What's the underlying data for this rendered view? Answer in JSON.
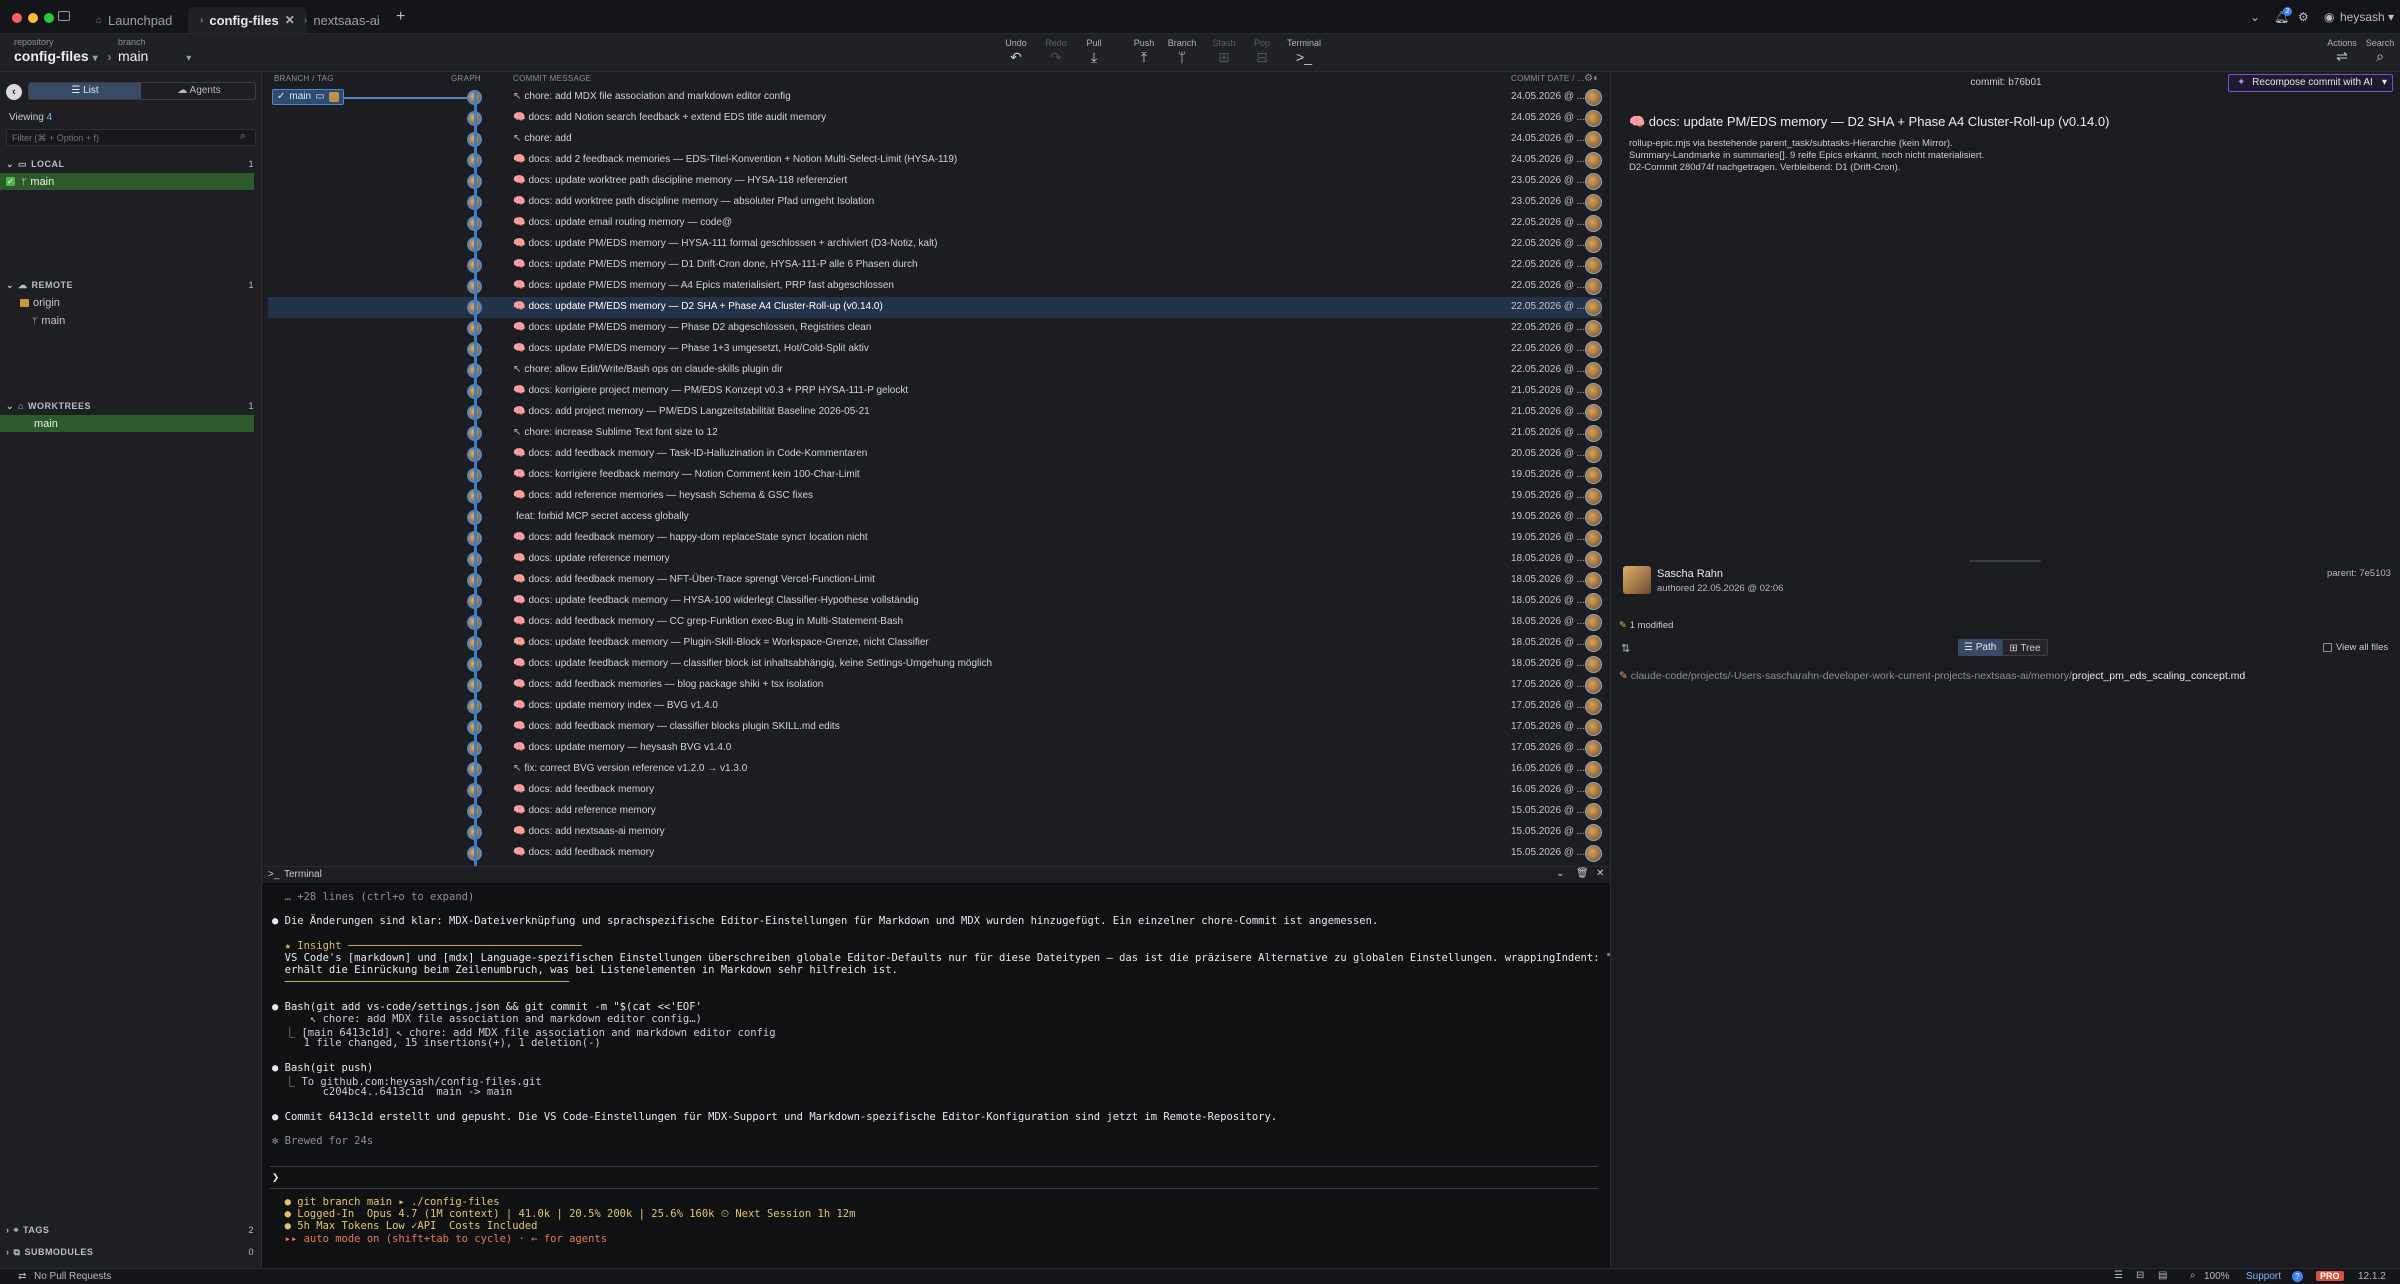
{
  "titlebar": {
    "tabs": [
      {
        "label": "Launchpad",
        "active": false
      },
      {
        "label": "config-files",
        "active": true
      },
      {
        "label": "nextsaas-ai",
        "active": false
      }
    ],
    "notification_count": "2",
    "user": "heysash"
  },
  "toolbar": {
    "repository_label": "repository",
    "repository": "config-files",
    "branch_label": "branch",
    "branch": "main",
    "tools": [
      {
        "label": "Undo",
        "icon": "↶",
        "enabled": true
      },
      {
        "label": "Redo",
        "icon": "↷",
        "enabled": false
      },
      {
        "label": "Pull",
        "icon": "⤓",
        "enabled": true
      },
      {
        "label": "Push",
        "icon": "⤒",
        "enabled": true
      },
      {
        "label": "Branch",
        "icon": "ᛘ",
        "enabled": true
      },
      {
        "label": "Stash",
        "icon": "⊞",
        "enabled": false
      },
      {
        "label": "Pop",
        "icon": "⊟",
        "enabled": false
      },
      {
        "label": "Terminal",
        "icon": ">_",
        "enabled": true
      }
    ],
    "actions_label": "Actions",
    "search_label": "Search"
  },
  "left": {
    "view_list": "List",
    "view_agents": "Agents",
    "viewing_label": "Viewing",
    "viewing_count": "4",
    "filter_placeholder": "Filter (⌘ + Option + f)",
    "local": {
      "title": "LOCAL",
      "count": "1",
      "items": [
        "main"
      ]
    },
    "remote": {
      "title": "REMOTE",
      "count": "1",
      "origin": "origin",
      "items": [
        "main"
      ]
    },
    "worktrees": {
      "title": "WORKTREES",
      "count": "1",
      "items": [
        "main"
      ]
    },
    "tags": {
      "title": "TAGS",
      "count": "2"
    },
    "submodules": {
      "title": "SUBMODULES",
      "count": "0"
    }
  },
  "list": {
    "headers": {
      "branch": "BRANCH / TAG",
      "graph": "GRAPH",
      "message": "COMMIT MESSAGE",
      "date": "COMMIT DATE / ..."
    },
    "branch_tag": "main",
    "selected_index": 10,
    "commits": [
      {
        "icon": "↖",
        "message": "chore: add MDX file association and markdown editor config",
        "date": "24.05.2026 @ ..."
      },
      {
        "icon": "🧠",
        "message": "docs: add Notion search feedback + extend EDS title audit memory",
        "date": "24.05.2026 @ ..."
      },
      {
        "icon": "↖",
        "message": "chore: add",
        "date": "24.05.2026 @ ..."
      },
      {
        "icon": "🧠",
        "message": "docs: add 2 feedback memories — EDS-Titel-Konvention + Notion Multi-Select-Limit (HYSA-119)",
        "date": "24.05.2026 @ ..."
      },
      {
        "icon": "🧠",
        "message": "docs: update worktree path discipline memory — HYSA-118 referenziert",
        "date": "23.05.2026 @ ..."
      },
      {
        "icon": "🧠",
        "message": "docs: add worktree path discipline memory — absoluter Pfad umgeht Isolation",
        "date": "23.05.2026 @ ..."
      },
      {
        "icon": "🧠",
        "message": "docs: update email routing memory — code@",
        "date": "22.05.2026 @ ..."
      },
      {
        "icon": "🧠",
        "message": "docs: update PM/EDS memory — HYSA-111 formal geschlossen + archiviert (D3-Notiz, kalt)",
        "date": "22.05.2026 @ ..."
      },
      {
        "icon": "🧠",
        "message": "docs: update PM/EDS memory — D1 Drift-Cron done, HYSA-111-P alle 6 Phasen durch",
        "date": "22.05.2026 @ ..."
      },
      {
        "icon": "🧠",
        "message": "docs: update PM/EDS memory — A4 Epics materialisiert, PRP fast abgeschlossen",
        "date": "22.05.2026 @ ..."
      },
      {
        "icon": "🧠",
        "message": "docs: update PM/EDS memory — D2 SHA + Phase A4 Cluster-Roll-up (v0.14.0)",
        "date": "22.05.2026 @ ..."
      },
      {
        "icon": "🧠",
        "message": "docs: update PM/EDS memory — Phase D2 abgeschlossen, Registries clean",
        "date": "22.05.2026 @ ..."
      },
      {
        "icon": "🧠",
        "message": "docs: update PM/EDS memory — Phase 1+3 umgesetzt, Hot/Cold-Split aktiv",
        "date": "22.05.2026 @ ..."
      },
      {
        "icon": "↖",
        "message": "chore: allow Edit/Write/Bash ops on claude-skills plugin dir",
        "date": "22.05.2026 @ ..."
      },
      {
        "icon": "🧠",
        "message": "docs: korrigiere project memory — PM/EDS Konzept v0.3 + PRP HYSA-111-P gelockt",
        "date": "21.05.2026 @ ..."
      },
      {
        "icon": "🧠",
        "message": "docs: add project memory — PM/EDS Langzeitstabilität Baseline 2026-05-21",
        "date": "21.05.2026 @ ..."
      },
      {
        "icon": "↖",
        "message": "chore: increase Sublime Text font size to 12",
        "date": "21.05.2026 @ ..."
      },
      {
        "icon": "🧠",
        "message": "docs: add feedback memory — Task-ID-Halluzination in Code-Kommentaren",
        "date": "20.05.2026 @ ..."
      },
      {
        "icon": "🧠",
        "message": "docs: korrigiere feedback memory — Notion Comment kein 100-Char-Limit",
        "date": "19.05.2026 @ ..."
      },
      {
        "icon": "🧠",
        "message": "docs: add reference memories — heysash Schema & GSC fixes",
        "date": "19.05.2026 @ ..."
      },
      {
        "icon": "",
        "message": "feat: forbid MCP secret access globally",
        "date": "19.05.2026 @ ..."
      },
      {
        "icon": "🧠",
        "message": "docs: add feedback memory — happy-dom replaceState syncт location nicht",
        "date": "19.05.2026 @ ..."
      },
      {
        "icon": "🧠",
        "message": "docs: update reference memory",
        "date": "18.05.2026 @ ..."
      },
      {
        "icon": "🧠",
        "message": "docs: add feedback memory — NFT-Über-Trace sprengt Vercel-Function-Limit",
        "date": "18.05.2026 @ ..."
      },
      {
        "icon": "🧠",
        "message": "docs: update feedback memory — HYSA-100 widerlegt Classifier-Hypothese vollständig",
        "date": "18.05.2026 @ ..."
      },
      {
        "icon": "🧠",
        "message": "docs: add feedback memory — CC grep-Funktion exec-Bug in Multi-Statement-Bash",
        "date": "18.05.2026 @ ..."
      },
      {
        "icon": "🧠",
        "message": "docs: update feedback memory — Plugin-Skill-Block = Workspace-Grenze, nicht Classifier",
        "date": "18.05.2026 @ ..."
      },
      {
        "icon": "🧠",
        "message": "docs: update feedback memory — classifier block ist inhaltsabhängig, keine Settings-Umgehung möglich",
        "date": "18.05.2026 @ ..."
      },
      {
        "icon": "🧠",
        "message": "docs: add feedback memories — blog package shiki + tsx isolation",
        "date": "17.05.2026 @ ..."
      },
      {
        "icon": "🧠",
        "message": "docs: update memory index — BVG v1.4.0",
        "date": "17.05.2026 @ ..."
      },
      {
        "icon": "🧠",
        "message": "docs: add feedback memory — classifier blocks plugin SKILL.md edits",
        "date": "17.05.2026 @ ..."
      },
      {
        "icon": "🧠",
        "message": "docs: update memory — heysash BVG v1.4.0",
        "date": "17.05.2026 @ ..."
      },
      {
        "icon": "↖",
        "message": "fix: correct BVG version reference v1.2.0 → v1.3.0",
        "date": "16.05.2026 @ ..."
      },
      {
        "icon": "🧠",
        "message": "docs: add feedback memory",
        "date": "16.05.2026 @ ..."
      },
      {
        "icon": "🧠",
        "message": "docs: add reference memory",
        "date": "15.05.2026 @ ..."
      },
      {
        "icon": "🧠",
        "message": "docs: add nextsaas-ai memory",
        "date": "15.05.2026 @ ..."
      },
      {
        "icon": "🧠",
        "message": "docs: add feedback memory",
        "date": "15.05.2026 @ ..."
      }
    ]
  },
  "terminal": {
    "title": "Terminal",
    "lines": [
      {
        "text": "  … +28 lines (ctrl+o to expand)",
        "color": "#8b9099"
      },
      {
        "text": "",
        "color": "#d4d6da"
      },
      {
        "text": "● Die Änderungen sind klar: MDX-Dateiverknüpfung und sprachspezifische Editor-Einstellungen für Markdown und MDX wurden hinzugefügt. Ein einzelner chore-Commit ist angemessen.",
        "color": "#e6e8eb"
      },
      {
        "text": "",
        "color": "#d4d6da"
      },
      {
        "text": "  ★ Insight ─────────────────────────────────────",
        "color": "#d9b96a"
      },
      {
        "text": "  VS Code's [markdown] und [mdx] Language-spezifischen Einstellungen überschreiben globale Editor-Defaults nur für diese Dateitypen — das ist die präzisere Alternative zu globalen Einstellungen. wrappingIndent: \"same\"",
        "color": "#e6e8eb"
      },
      {
        "text": "  erhält die Einrückung beim Zeilenumbruch, was bei Listenelementen in Markdown sehr hilfreich ist.",
        "color": "#e6e8eb"
      },
      {
        "text": "  ─────────────────────────────────────────────",
        "color": "#d9b96a"
      },
      {
        "text": "",
        "color": "#d4d6da"
      },
      {
        "text": "● Bash(git add vs-code/settings.json && git commit -m \"$(cat <<'EOF'",
        "color": "#e6e8eb"
      },
      {
        "text": "      ↖ chore: add MDX file association and markdown editor config…)",
        "color": "#c9ccd1"
      },
      {
        "text": "  ⎿ [main 6413c1d] ↖ chore: add MDX file association and markdown editor config",
        "color": "#c9ccd1"
      },
      {
        "text": "     1 file changed, 15 insertions(+), 1 deletion(-)",
        "color": "#c9ccd1"
      },
      {
        "text": "",
        "color": "#d4d6da"
      },
      {
        "text": "● Bash(git push)",
        "color": "#e6e8eb"
      },
      {
        "text": "  ⎿ To github.com:heysash/config-files.git",
        "color": "#c9ccd1"
      },
      {
        "text": "        c204bc4..6413c1d  main -> main",
        "color": "#c9ccd1"
      },
      {
        "text": "",
        "color": "#d4d6da"
      },
      {
        "text": "● Commit 6413c1d erstellt und gepusht. Die VS Code-Einstellungen für MDX-Support und Markdown-spezifische Editor-Konfiguration sind jetzt im Remote-Repository.",
        "color": "#e6e8eb"
      },
      {
        "text": "",
        "color": "#d4d6da"
      },
      {
        "text": "✻ Brewed for 24s",
        "color": "#8b9099"
      }
    ],
    "prompt": "❯",
    "status_lines": [
      {
        "text": "  ● git branch main ▸ ./config-files",
        "color": "#e3c46e"
      },
      {
        "text": "  ● Logged-In  Opus 4.7 (1M context) | 41.0k | 20.5% 200k | 25.6% 160k ⏲ Next Session 1h 12m",
        "color": "#e3c46e"
      },
      {
        "text": "  ● 5h Max Tokens Low ✓API  Costs Included",
        "color": "#e3c46e"
      },
      {
        "text": "  ▸▸ auto mode on (shift+tab to cycle) · ← for agents",
        "color": "#e57a5a"
      }
    ]
  },
  "right": {
    "commit_label": "commit:",
    "commit_sha": "b76b01",
    "recompose_label": "Recompose commit with AI",
    "title": "🧠 docs: update PM/EDS memory — D2 SHA + Phase A4 Cluster-Roll-up (v0.14.0)",
    "body": [
      "rollup-epic.mjs via bestehende parent_task/subtasks-Hierarchie (kein Mirror).",
      "Summary-Landmarke in summaries[]. 9 reife Epics erkannt, noch nicht materialisiert.",
      "D2-Commit 280d74f nachgetragen. Verbleibend: D1 (Drift-Cron)."
    ],
    "author": "Sascha Rahn",
    "authored": "authored 22.05.2026 @ 02:06",
    "parent_label": "parent:",
    "parent_sha": "7e5103",
    "modified": "1 modified",
    "path_label": "Path",
    "tree_label": "Tree",
    "view_all": "View all files",
    "file_dir": "claude-code/projects/-Users-sascharahn-developer-work-current-projects-nextsaas-ai/memory/",
    "file_name": "project_pm_eds_scaling_concept.md"
  },
  "status": {
    "pull_requests": "No Pull Requests",
    "zoom": "100%",
    "support": "Support",
    "pro": "PRO",
    "version": "12.1.2"
  },
  "colors": {
    "accent": "#4f87c7",
    "selected_branch": "#2d5a2a",
    "selected_row": "#223247",
    "recompose_border": "#7a4fd1",
    "pro_badge": "#d8503f"
  }
}
